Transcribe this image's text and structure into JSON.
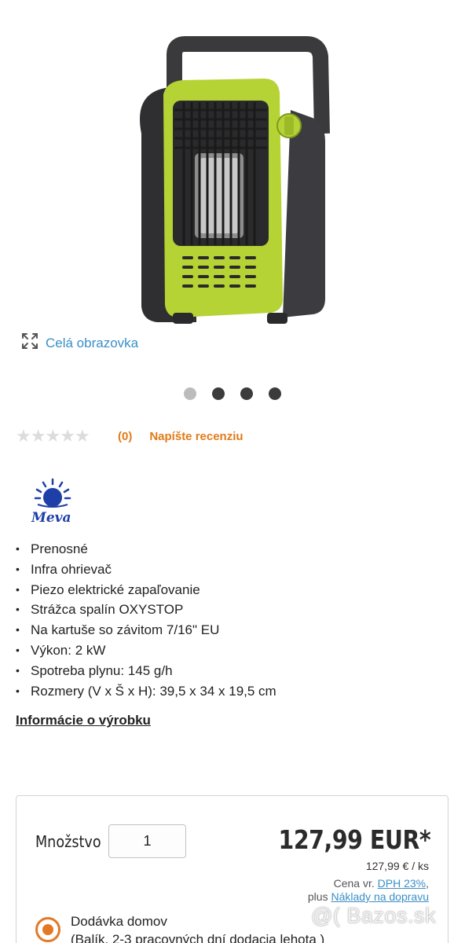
{
  "gallery": {
    "fullscreen_label": "Celá obrazovka",
    "dots_total": 4,
    "active_dot": 1
  },
  "rating": {
    "stars_value": 0,
    "stars_max": 5,
    "review_count": "(0)",
    "write_review_label": "Napíšte recenziu"
  },
  "brand": {
    "logo_text": "Meva"
  },
  "features": [
    "Prenosné",
    "Infra ohrievač",
    "Piezo elektrické zapaľovanie",
    "Strážca spalín OXYSTOP",
    "Na kartuše so závitom 7/16\" EU",
    "Výkon: 2 kW",
    "Spotreba plynu: 145 g/h",
    "Rozmery (V x Š x H): 39,5 x 34 x 19,5 cm"
  ],
  "product_info_link": "Informácie o výrobku",
  "purchase": {
    "quantity_label": "Množstvo",
    "quantity_value": "1",
    "price": "127,99 EUR*",
    "price_per_unit": "127,99 € / ks",
    "vat_prefix": "Cena vr. ",
    "vat_link": "DPH 23%",
    "vat_suffix": ",",
    "shipping_prefix": "plus ",
    "shipping_link": "Náklady na dopravu",
    "delivery_title": "Dodávka domov",
    "delivery_subtitle": "(Balík, 2-3 pracovných dní dodacia lehota )"
  },
  "watermark": "@( Bazos.sk",
  "colors": {
    "accent_orange": "#e07b1a",
    "link_blue": "#3a8fc7",
    "heater_green": "#b5d334"
  }
}
